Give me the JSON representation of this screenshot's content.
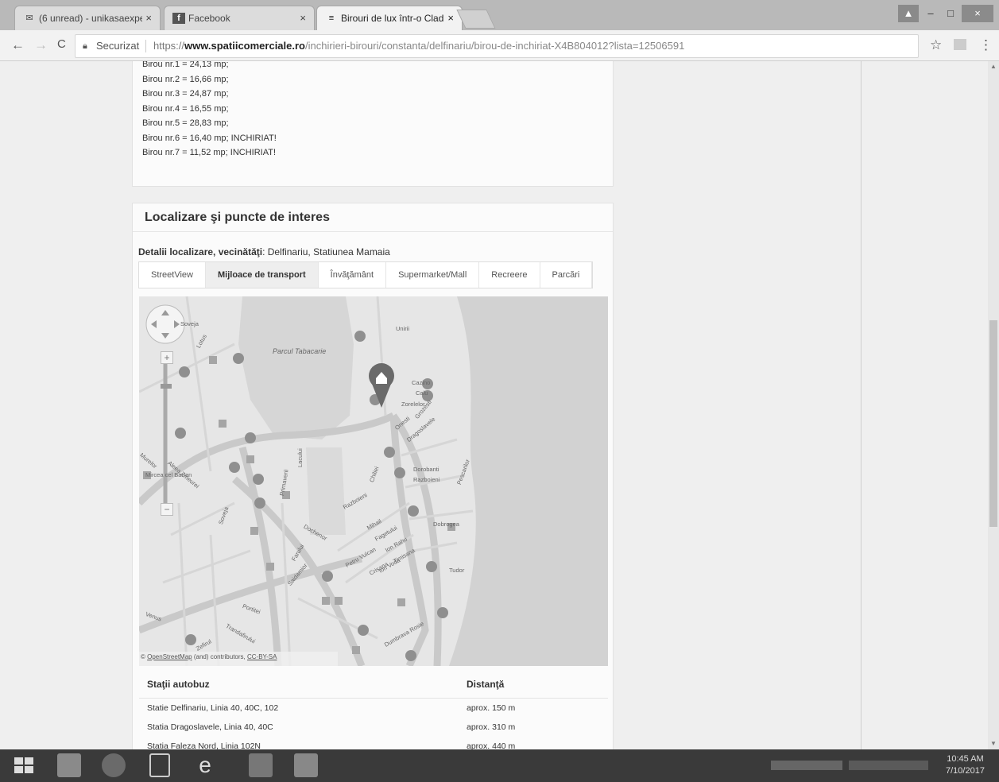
{
  "browser": {
    "tabs": [
      {
        "label": "(6 unread) - unikasaexpe",
        "icon": "mail-icon",
        "close": "×"
      },
      {
        "label": "Facebook",
        "icon": "facebook-icon",
        "close": "×"
      },
      {
        "label": "Birouri de lux într-o Clad",
        "icon": "site-icon",
        "close": "×"
      }
    ],
    "url_secure_label": "Securizat",
    "url_prefix": "https://",
    "url_domain": "www.spatiicomerciale.ro",
    "url_path": "/inchirieri-birouri/constanta/delfinariu/birou-de-inchiriat-X4B804012?lista=12506591",
    "back": "←",
    "forward": "→",
    "reload": "C",
    "star": "☆",
    "menu": "⋮",
    "win_min": "–",
    "win_max": "□",
    "win_close": "×"
  },
  "offices": [
    "Birou nr.1 = 24,13 mp;",
    "Birou nr.2 = 16,66 mp;",
    "Birou nr.3 = 24,87 mp;",
    "Birou nr.4 = 16,55 mp;",
    "Birou nr.5 = 28,83 mp;",
    "Birou nr.6 = 16,40 mp; INCHIRIAT!",
    "Birou nr.7 = 11,52 mp; INCHIRIAT!"
  ],
  "location": {
    "title": "Localizare şi puncte de interes",
    "neigh_label": "Detalii localizare, vecinătăţi",
    "neigh_value": ": Delfinariu, Statiunea Mamaia",
    "tabs": [
      "StreetView",
      "Mijloace de transport",
      "Învăţământ",
      "Supermarket/Mall",
      "Recreere",
      "Parcări"
    ],
    "selected_tab": "Mijloace de transport"
  },
  "map": {
    "park_label": "Parcul Tabacarie",
    "street_labels": [
      "Lotus",
      "Soveja",
      "Unirii",
      "Cazino",
      "Calu",
      "Zorelelor",
      "Grozesti",
      "Onesti",
      "Dragoslavele",
      "Dorobanti",
      "Razboieni",
      "Mircea cel Batran",
      "Murelor",
      "Aleea Zmeurei",
      "Primaverii",
      "Chiliei",
      "Razboieni",
      "Mihail",
      "Fagetului",
      "Ion Rahu",
      "Timisana",
      "Petru Vulcan",
      "Crisana",
      "Ion Voda",
      "Soveja",
      "Dochenor",
      "Farului",
      "Saidamior",
      "Portitei",
      "Trandafirului",
      "Zefirul",
      "Venus",
      "Dumbrava Rosie",
      "Pescarilor",
      "Tudor",
      "Dobrogea",
      "Lacului"
    ],
    "attribution_pre": "© ",
    "attribution_link": "OpenStreetMap",
    "attribution_mid": " (and) contributors, ",
    "attribution_lic": "CC-BY-SA",
    "zoom_in": "+",
    "zoom_out": "−"
  },
  "stations": {
    "header_name": "Staţii autobuz",
    "header_dist": "Distanţă",
    "rows": [
      {
        "name": "Statie Delfinariu, Linia 40, 40C, 102",
        "dist": "aprox. 150 m"
      },
      {
        "name": "Statia Dragoslavele, Linia 40, 40C",
        "dist": "aprox. 310 m"
      },
      {
        "name": "Statia Faleza Nord, Linia 102N",
        "dist": "aprox. 440 m"
      }
    ]
  },
  "taskbar": {
    "time": "10:45 AM",
    "date": "7/10/2017"
  },
  "colors": {
    "tabbar": "#b9b9b9",
    "taskbar": "#3a3a3a",
    "map_water": "#d2d2d2",
    "map_road": "#c6c6c6",
    "marker": "#6a6a6a"
  }
}
